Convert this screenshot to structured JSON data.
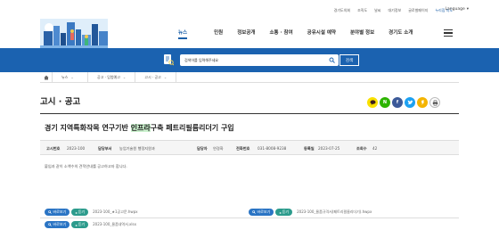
{
  "utility": {
    "links": [
      "경기도의회",
      "조직도",
      "날씨",
      "대기정보",
      "글로벌페이지",
      "누리집 지도"
    ],
    "language": "Language"
  },
  "nav": {
    "items": [
      "뉴스",
      "민원",
      "정보공개",
      "소통 · 참여",
      "공유시설 예약",
      "분야별 정보",
      "경기도 소개"
    ],
    "active_index": 0
  },
  "search": {
    "placeholder": "검색어를 입력해주세요",
    "button": "검색"
  },
  "breadcrumb": {
    "items": [
      "뉴스",
      "공고 · 입법예고",
      "고시 · 공고"
    ]
  },
  "page": {
    "title": "고시 · 공고"
  },
  "share": {
    "icons": [
      "kakaotalk-icon",
      "naver-icon",
      "facebook-icon",
      "twitter-icon",
      "kakaostory-icon",
      "print-icon"
    ],
    "colors": {
      "kakao": "#f9e000",
      "naver": "#2db400",
      "facebook": "#3b5998",
      "twitter": "#1da1f2",
      "story": "#f4b400"
    }
  },
  "post": {
    "title_before": "경기 지역특화작목 연구기반 ",
    "title_highlight": "인프라",
    "title_after": "구축 페트리필름리더기 구입",
    "meta": {
      "no_label": "고시번호",
      "no_value": "2023-100",
      "dept_label": "담당부서",
      "dept_value": "농업기술원 행정지원과",
      "person_label": "담당자",
      "person_value": "연경화",
      "phone_label": "전화번호",
      "phone_value": "031-8008-9238",
      "date_label": "등록일",
      "date_value": "2023-07-25",
      "views_label": "조회수",
      "views_value": "42"
    },
    "body": "붙임과 같이 소액수의 견적안내를 공고하고자 합니다."
  },
  "attachments": {
    "view_label": "바로보기",
    "download_label": "듣기",
    "files": [
      "2023-100_★1공고문.hwpx",
      "2023-100_물품규격서(페트리필름리더기).hwpx",
      "2023-100_물품내역서.xlsx"
    ]
  },
  "colors": {
    "brand_blue": "#1b62b0",
    "view_button": "#2a74c4",
    "download_button": "#2c9b8c",
    "highlight": "#c9f0cc"
  }
}
